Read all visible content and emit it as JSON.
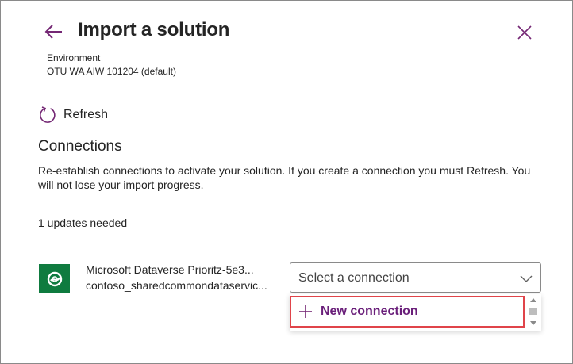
{
  "header": {
    "title": "Import a solution"
  },
  "environment": {
    "label": "Environment",
    "value": "OTU WA AIW 101204 (default)"
  },
  "refresh": {
    "label": "Refresh"
  },
  "connections": {
    "heading": "Connections",
    "description": "Re-establish connections to activate your solution. If you create a connection you must Refresh. You will not lose your import progress.",
    "updates_needed": "1 updates needed",
    "items": [
      {
        "name": "Microsoft Dataverse Prioritz-5e3...",
        "subtitle": "contoso_sharedcommondataservic...",
        "icon": "dataverse-icon",
        "select_placeholder": "Select a connection"
      }
    ]
  },
  "dropdown": {
    "new_connection_label": "New connection"
  },
  "colors": {
    "accent": "#742774",
    "dataverse_green": "#0f7b3f",
    "highlight_red": "#e0444a"
  }
}
